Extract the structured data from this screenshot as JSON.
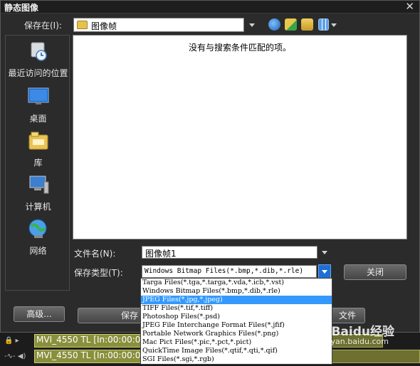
{
  "window": {
    "title": "静态图像",
    "close": "✕"
  },
  "save_in": {
    "label": "保存在(I):",
    "value": "图像帧"
  },
  "toolbar": {
    "back": "back-icon",
    "up": "up-folder-icon",
    "new_folder": "new-folder-icon",
    "view": "view-menu-icon"
  },
  "places": [
    {
      "label": "最近访问的位置",
      "icon": "recent-places-icon"
    },
    {
      "label": "桌面",
      "icon": "desktop-icon"
    },
    {
      "label": "库",
      "icon": "library-icon"
    },
    {
      "label": "计算机",
      "icon": "computer-icon"
    },
    {
      "label": "网络",
      "icon": "network-icon"
    }
  ],
  "file_list": {
    "empty_message": "没有与搜索条件匹配的项。"
  },
  "filename": {
    "label": "文件名(N):",
    "value": "图像帧1"
  },
  "filetype": {
    "label": "保存类型(T):",
    "value": "Windows Bitmap Files(*.bmp,*.dib,*.rle)",
    "options": [
      "Targa Files(*.tga,*.targa,*.vda,*.icb,*.vst)",
      "Windows Bitmap Files(*.bmp,*.dib,*.rle)",
      "JPEG Files(*.jpg,*.jpeg)",
      "TIFF Files(*.tif,*.tiff)",
      "Photoshop Files(*.psd)",
      "JPEG File Interchange Format Files(*.jfif)",
      "Portable Network Graphics Files(*.png)",
      "Mac Pict Files(*.pic,*.pct,*.pict)",
      "QuickTime Image Files(*.qtif,*.qti,*.qif)",
      "SGI Files(*.sgi,*.rgb)"
    ],
    "selected_index": 2
  },
  "buttons": {
    "close": "关闭",
    "advanced": "高级...",
    "save_partial": "保存",
    "file_partial": "文件"
  },
  "timeline": {
    "row1": "MVI_4550 TL [In:00:00:0",
    "row2": "MVI_4550 TL [In:00:00:0"
  },
  "watermark": {
    "brand": "Baidu经验",
    "url": "jingyan.baidu.com"
  }
}
